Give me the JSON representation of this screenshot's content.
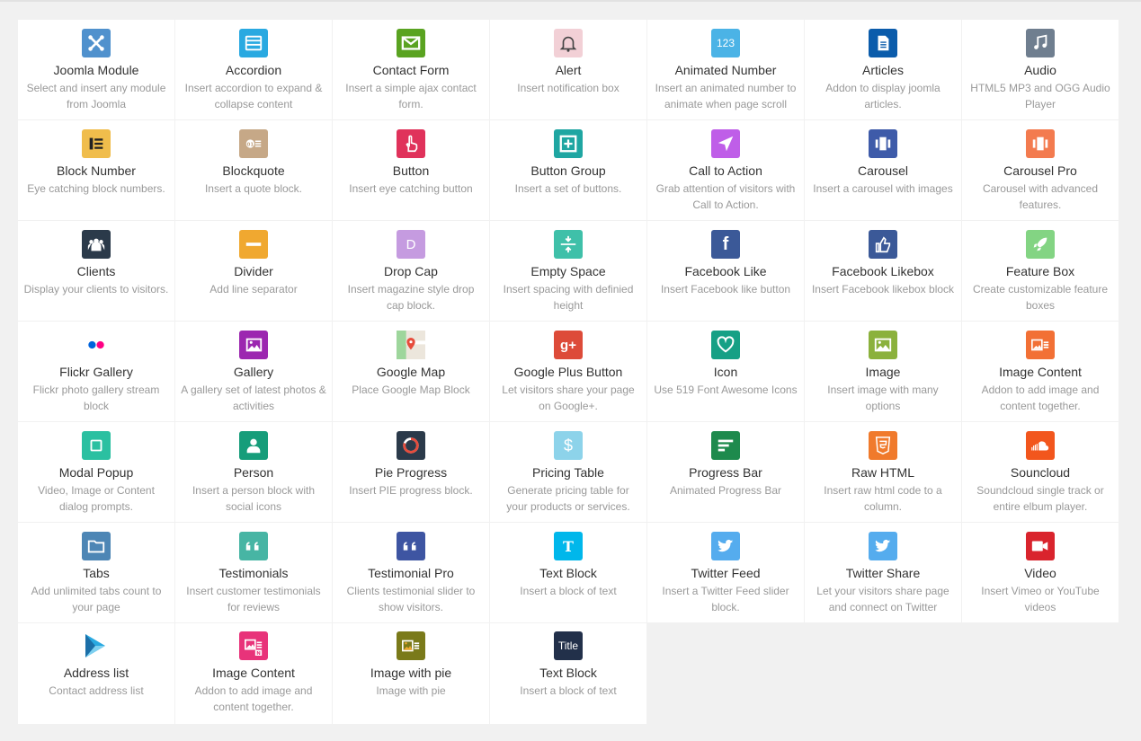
{
  "addons": [
    {
      "title": "Joomla Module",
      "desc": "Select and insert any module from Joomla",
      "icon": "joomla-icon",
      "color": "#5091cd"
    },
    {
      "title": "Accordion",
      "desc": "Insert accordion to expand & collapse content",
      "icon": "accordion-icon",
      "color": "#29a9e1"
    },
    {
      "title": "Contact Form",
      "desc": "Insert a simple ajax contact form.",
      "icon": "envelope-icon",
      "color": "#5aa321"
    },
    {
      "title": "Alert",
      "desc": "Insert notification box",
      "icon": "bell-icon",
      "color": "#f2d0d6"
    },
    {
      "title": "Animated Number",
      "desc": "Insert an animated number to animate when page scroll",
      "icon": "number-icon",
      "color": "#4bb3e6",
      "glyph": "123"
    },
    {
      "title": "Articles",
      "desc": "Addon to display joomla articles.",
      "icon": "document-icon",
      "color": "#0b5cab"
    },
    {
      "title": "Audio",
      "desc": "HTML5 MP3 and OGG Audio Player",
      "icon": "music-icon",
      "color": "#6f7e8f"
    },
    {
      "title": "Block Number",
      "desc": "Eye catching block numbers.",
      "icon": "list-icon",
      "color": "#f0bd4c"
    },
    {
      "title": "Blockquote",
      "desc": "Insert a quote block.",
      "icon": "quote-block-icon",
      "color": "#c6a887"
    },
    {
      "title": "Button",
      "desc": "Insert eye catching button",
      "icon": "hand-pointer-icon",
      "color": "#e0325b"
    },
    {
      "title": "Button Group",
      "desc": "Insert a set of buttons.",
      "icon": "plus-square-icon",
      "color": "#1fa6a2"
    },
    {
      "title": "Call to Action",
      "desc": "Grab attention of visitors with Call to Action.",
      "icon": "location-arrow-icon",
      "color": "#bf5ee8"
    },
    {
      "title": "Carousel",
      "desc": "Insert a carousel with images",
      "icon": "carousel-icon",
      "color": "#3e5ba9"
    },
    {
      "title": "Carousel Pro",
      "desc": "Carousel with advanced features.",
      "icon": "carousel-pro-icon",
      "color": "#f37b4f"
    },
    {
      "title": "Clients",
      "desc": "Display your clients to visitors.",
      "icon": "users-icon",
      "color": "#2b3a4a"
    },
    {
      "title": "Divider",
      "desc": "Add line separator",
      "icon": "minus-icon",
      "color": "#f0a830"
    },
    {
      "title": "Drop Cap",
      "desc": "Insert magazine style drop cap block.",
      "icon": "dropcap-icon",
      "color": "#c59be0",
      "glyph": "D"
    },
    {
      "title": "Empty Space",
      "desc": "Insert spacing with definied height",
      "icon": "spacing-icon",
      "color": "#3fc0a9"
    },
    {
      "title": "Facebook Like",
      "desc": "Insert Facebook like button",
      "icon": "facebook-icon",
      "color": "#3b5998",
      "glyph": "f"
    },
    {
      "title": "Facebook Likebox",
      "desc": "Insert Facebook likebox block",
      "icon": "thumbs-up-icon",
      "color": "#3b5998"
    },
    {
      "title": "Feature Box",
      "desc": "Create customizable feature boxes",
      "icon": "rocket-icon",
      "color": "#83d483"
    },
    {
      "title": "Flickr Gallery",
      "desc": "Flickr photo gallery stream block",
      "icon": "flickr-icon",
      "color": "#ffffff"
    },
    {
      "title": "Gallery",
      "desc": "A gallery set of latest photos & activities",
      "icon": "picture-icon",
      "color": "#9c27b0"
    },
    {
      "title": "Google Map",
      "desc": "Place Google Map Block",
      "icon": "map-icon",
      "color": "#eaeaea"
    },
    {
      "title": "Google Plus Button",
      "desc": "Let visitors share your page on Google+.",
      "icon": "google-plus-icon",
      "color": "#dd4b39",
      "glyph": "g+"
    },
    {
      "title": "Icon",
      "desc": "Use 519 Font Awesome Icons",
      "icon": "heart-icon",
      "color": "#16a085"
    },
    {
      "title": "Image",
      "desc": "Insert image with many options",
      "icon": "image-icon",
      "color": "#8bb13c"
    },
    {
      "title": "Image Content",
      "desc": "Addon to add image and content together.",
      "icon": "image-content-icon",
      "color": "#f27035"
    },
    {
      "title": "Modal Popup",
      "desc": "Video, Image or Content dialog prompts.",
      "icon": "square-icon",
      "color": "#2bc0a1"
    },
    {
      "title": "Person",
      "desc": "Insert a person block with social icons",
      "icon": "person-icon",
      "color": "#169d7a"
    },
    {
      "title": "Pie Progress",
      "desc": "Insert PIE progress block.",
      "icon": "pie-progress-icon",
      "color": "#2b3a4a"
    },
    {
      "title": "Pricing Table",
      "desc": "Generate pricing table for your products or services.",
      "icon": "dollar-icon",
      "color": "#8dd3ea",
      "glyph": "$"
    },
    {
      "title": "Progress Bar",
      "desc": "Animated Progress Bar",
      "icon": "progress-bar-icon",
      "color": "#1e8a4d"
    },
    {
      "title": "Raw HTML",
      "desc": "Insert raw html code to a column.",
      "icon": "html5-icon",
      "color": "#f07a2c"
    },
    {
      "title": "Souncloud",
      "desc": "Soundcloud single track or entire elbum player.",
      "icon": "soundcloud-icon",
      "color": "#f2561d"
    },
    {
      "title": "Tabs",
      "desc": "Add unlimited tabs count to your page",
      "icon": "folder-icon",
      "color": "#4d86b5"
    },
    {
      "title": "Testimonials",
      "desc": "Insert customer testimonials for reviews",
      "icon": "quote-icon",
      "color": "#47b5a4"
    },
    {
      "title": "Testimonial Pro",
      "desc": "Clients testimonial slider to show visitors.",
      "icon": "quote-pro-icon",
      "color": "#3e55a2"
    },
    {
      "title": "Text Block",
      "desc": "Insert a block of text",
      "icon": "text-icon",
      "color": "#00b7eb",
      "glyph": "T"
    },
    {
      "title": "Twitter Feed",
      "desc": "Insert a Twitter Feed slider block.",
      "icon": "twitter-icon",
      "color": "#55acee"
    },
    {
      "title": "Twitter Share",
      "desc": "Let your visitors share page and connect on Twitter",
      "icon": "twitter-share-icon",
      "color": "#55acee"
    },
    {
      "title": "Video",
      "desc": "Insert Vimeo or YouTube videos",
      "icon": "video-camera-icon",
      "color": "#d9242d"
    },
    {
      "title": "Address list",
      "desc": "Contact address list",
      "icon": "address-play-icon",
      "color": "#ffffff"
    },
    {
      "title": "Image Content",
      "desc": "Addon to add image and content together.",
      "icon": "image-content-n-icon",
      "color": "#e8337a"
    },
    {
      "title": "Image with pie",
      "desc": "Image with pie",
      "icon": "image-pie-icon",
      "color": "#7a7a1a"
    },
    {
      "title": "Text Block",
      "desc": "Insert a block of text",
      "icon": "title-icon",
      "color": "#22304a",
      "glyph": "Title"
    }
  ]
}
